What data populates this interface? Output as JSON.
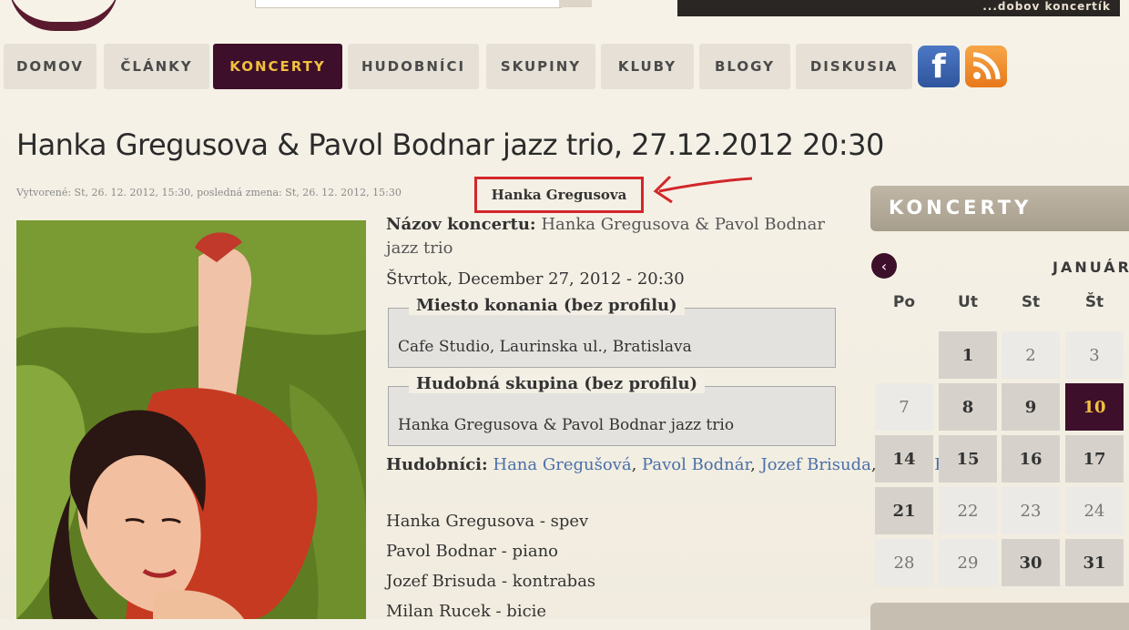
{
  "banner": {
    "text": "...dobov koncertík"
  },
  "nav": {
    "items": [
      {
        "label": "DOMOV"
      },
      {
        "label": "ČLÁNKY"
      },
      {
        "label": "KONCERTY"
      },
      {
        "label": "HUDOBNÍCI"
      },
      {
        "label": "SKUPINY"
      },
      {
        "label": "KLUBY"
      },
      {
        "label": "BLOGY"
      },
      {
        "label": "DISKUSIA"
      }
    ],
    "active": "KONCERTY",
    "social": [
      {
        "icon": "facebook-icon",
        "glyph": "f"
      },
      {
        "icon": "rss-icon"
      }
    ]
  },
  "article": {
    "title": "Hanka Gregusova & Pavol Bodnar jazz trio, 27.12.2012 20:30",
    "meta": "Vytvorené: St, 26. 12. 2012, 15:30, posledná zmena: St, 26. 12. 2012, 15:30",
    "author": "Hanka Gregusova",
    "concert_name_label": "Názov koncertu:",
    "concert_name_value_line1": "Hanka Gregusova & Pavol Bodnar",
    "concert_name_value_line2": "jazz trio",
    "date": "Štvrtok, December 27, 2012 - 20:30",
    "venue_legend": "Miesto konania (bez profilu)",
    "venue_value": "Cafe Studio, Laurinska ul., Bratislava",
    "band_legend": "Hudobná skupina (bez profilu)",
    "band_value": "Hanka Gregusova & Pavol Bodnar jazz trio",
    "musicians_label": "Hudobníci:",
    "musicians_links": [
      "Hana Gregušová",
      "Pavol Bodnár",
      "Jozef Brisuda",
      "Milan Ruček"
    ],
    "lineup": [
      "Hanka Gregusova - spev",
      "Pavol Bodnar - piano",
      "Jozef Brisuda - kontrabas",
      "Milan Rucek - bicie"
    ]
  },
  "sidebar": {
    "heading": "KONCERTY",
    "month": "JANUÁR",
    "weekdays": [
      "Po",
      "Ut",
      "St",
      "Št"
    ],
    "weeks": [
      [
        null,
        {
          "d": "1",
          "t": "event"
        },
        {
          "d": "2",
          "t": "plain"
        },
        {
          "d": "3",
          "t": "plain"
        }
      ],
      [
        {
          "d": "7",
          "t": "plain"
        },
        {
          "d": "8",
          "t": "event"
        },
        {
          "d": "9",
          "t": "event"
        },
        {
          "d": "10",
          "t": "today"
        }
      ],
      [
        {
          "d": "14",
          "t": "event"
        },
        {
          "d": "15",
          "t": "event"
        },
        {
          "d": "16",
          "t": "event"
        },
        {
          "d": "17",
          "t": "event"
        }
      ],
      [
        {
          "d": "21",
          "t": "event"
        },
        {
          "d": "22",
          "t": "plain"
        },
        {
          "d": "23",
          "t": "plain"
        },
        {
          "d": "24",
          "t": "plain"
        }
      ],
      [
        {
          "d": "28",
          "t": "plain"
        },
        {
          "d": "29",
          "t": "plain"
        },
        {
          "d": "30",
          "t": "event"
        },
        {
          "d": "31",
          "t": "event"
        }
      ]
    ]
  },
  "colors": {
    "accent": "#3e0f2a",
    "active_text": "#f0c040",
    "highlight_red": "#d2262a",
    "link": "#4a6fa8"
  }
}
